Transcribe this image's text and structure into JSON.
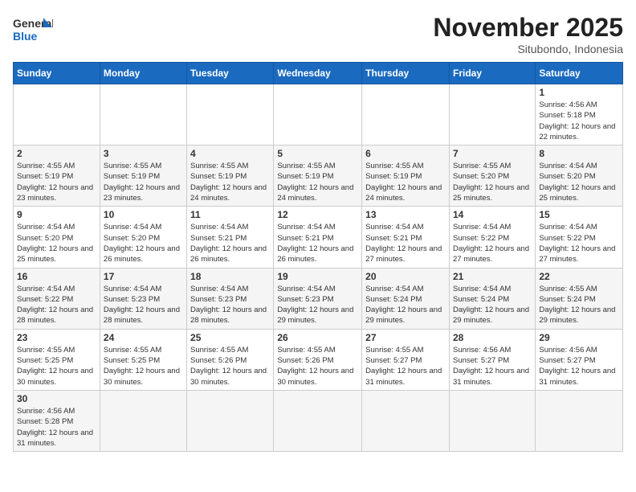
{
  "logo": {
    "text_general": "General",
    "text_blue": "Blue"
  },
  "title": {
    "month_year": "November 2025",
    "location": "Situbondo, Indonesia"
  },
  "days_of_week": [
    "Sunday",
    "Monday",
    "Tuesday",
    "Wednesday",
    "Thursday",
    "Friday",
    "Saturday"
  ],
  "weeks": [
    [
      {
        "day": "",
        "info": ""
      },
      {
        "day": "",
        "info": ""
      },
      {
        "day": "",
        "info": ""
      },
      {
        "day": "",
        "info": ""
      },
      {
        "day": "",
        "info": ""
      },
      {
        "day": "",
        "info": ""
      },
      {
        "day": "1",
        "info": "Sunrise: 4:56 AM\nSunset: 5:18 PM\nDaylight: 12 hours and 22 minutes."
      }
    ],
    [
      {
        "day": "2",
        "info": "Sunrise: 4:55 AM\nSunset: 5:19 PM\nDaylight: 12 hours and 23 minutes."
      },
      {
        "day": "3",
        "info": "Sunrise: 4:55 AM\nSunset: 5:19 PM\nDaylight: 12 hours and 23 minutes."
      },
      {
        "day": "4",
        "info": "Sunrise: 4:55 AM\nSunset: 5:19 PM\nDaylight: 12 hours and 24 minutes."
      },
      {
        "day": "5",
        "info": "Sunrise: 4:55 AM\nSunset: 5:19 PM\nDaylight: 12 hours and 24 minutes."
      },
      {
        "day": "6",
        "info": "Sunrise: 4:55 AM\nSunset: 5:19 PM\nDaylight: 12 hours and 24 minutes."
      },
      {
        "day": "7",
        "info": "Sunrise: 4:55 AM\nSunset: 5:20 PM\nDaylight: 12 hours and 25 minutes."
      },
      {
        "day": "8",
        "info": "Sunrise: 4:54 AM\nSunset: 5:20 PM\nDaylight: 12 hours and 25 minutes."
      }
    ],
    [
      {
        "day": "9",
        "info": "Sunrise: 4:54 AM\nSunset: 5:20 PM\nDaylight: 12 hours and 25 minutes."
      },
      {
        "day": "10",
        "info": "Sunrise: 4:54 AM\nSunset: 5:20 PM\nDaylight: 12 hours and 26 minutes."
      },
      {
        "day": "11",
        "info": "Sunrise: 4:54 AM\nSunset: 5:21 PM\nDaylight: 12 hours and 26 minutes."
      },
      {
        "day": "12",
        "info": "Sunrise: 4:54 AM\nSunset: 5:21 PM\nDaylight: 12 hours and 26 minutes."
      },
      {
        "day": "13",
        "info": "Sunrise: 4:54 AM\nSunset: 5:21 PM\nDaylight: 12 hours and 27 minutes."
      },
      {
        "day": "14",
        "info": "Sunrise: 4:54 AM\nSunset: 5:22 PM\nDaylight: 12 hours and 27 minutes."
      },
      {
        "day": "15",
        "info": "Sunrise: 4:54 AM\nSunset: 5:22 PM\nDaylight: 12 hours and 27 minutes."
      }
    ],
    [
      {
        "day": "16",
        "info": "Sunrise: 4:54 AM\nSunset: 5:22 PM\nDaylight: 12 hours and 28 minutes."
      },
      {
        "day": "17",
        "info": "Sunrise: 4:54 AM\nSunset: 5:23 PM\nDaylight: 12 hours and 28 minutes."
      },
      {
        "day": "18",
        "info": "Sunrise: 4:54 AM\nSunset: 5:23 PM\nDaylight: 12 hours and 28 minutes."
      },
      {
        "day": "19",
        "info": "Sunrise: 4:54 AM\nSunset: 5:23 PM\nDaylight: 12 hours and 29 minutes."
      },
      {
        "day": "20",
        "info": "Sunrise: 4:54 AM\nSunset: 5:24 PM\nDaylight: 12 hours and 29 minutes."
      },
      {
        "day": "21",
        "info": "Sunrise: 4:54 AM\nSunset: 5:24 PM\nDaylight: 12 hours and 29 minutes."
      },
      {
        "day": "22",
        "info": "Sunrise: 4:55 AM\nSunset: 5:24 PM\nDaylight: 12 hours and 29 minutes."
      }
    ],
    [
      {
        "day": "23",
        "info": "Sunrise: 4:55 AM\nSunset: 5:25 PM\nDaylight: 12 hours and 30 minutes."
      },
      {
        "day": "24",
        "info": "Sunrise: 4:55 AM\nSunset: 5:25 PM\nDaylight: 12 hours and 30 minutes."
      },
      {
        "day": "25",
        "info": "Sunrise: 4:55 AM\nSunset: 5:26 PM\nDaylight: 12 hours and 30 minutes."
      },
      {
        "day": "26",
        "info": "Sunrise: 4:55 AM\nSunset: 5:26 PM\nDaylight: 12 hours and 30 minutes."
      },
      {
        "day": "27",
        "info": "Sunrise: 4:55 AM\nSunset: 5:27 PM\nDaylight: 12 hours and 31 minutes."
      },
      {
        "day": "28",
        "info": "Sunrise: 4:56 AM\nSunset: 5:27 PM\nDaylight: 12 hours and 31 minutes."
      },
      {
        "day": "29",
        "info": "Sunrise: 4:56 AM\nSunset: 5:27 PM\nDaylight: 12 hours and 31 minutes."
      }
    ],
    [
      {
        "day": "30",
        "info": "Sunrise: 4:56 AM\nSunset: 5:28 PM\nDaylight: 12 hours and 31 minutes."
      },
      {
        "day": "",
        "info": ""
      },
      {
        "day": "",
        "info": ""
      },
      {
        "day": "",
        "info": ""
      },
      {
        "day": "",
        "info": ""
      },
      {
        "day": "",
        "info": ""
      },
      {
        "day": "",
        "info": ""
      }
    ]
  ]
}
